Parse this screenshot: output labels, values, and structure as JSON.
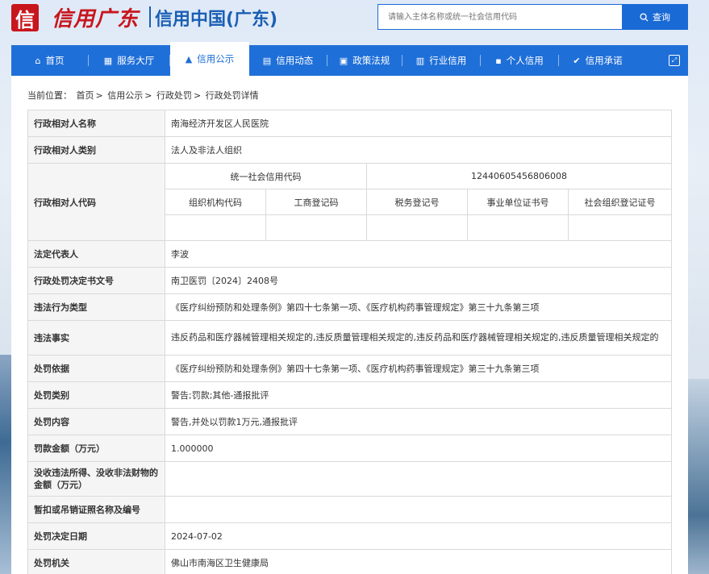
{
  "header": {
    "logo_char": "信",
    "logo_script": "信用广东",
    "site_title": "信用中国(广东)",
    "search_placeholder": "请输入主体名称或统一社会信用代码",
    "search_button": "查询"
  },
  "nav": [
    {
      "label": "首页",
      "icon": "home-icon",
      "glyph": "⌂"
    },
    {
      "label": "服务大厅",
      "icon": "grid-icon",
      "glyph": "▦"
    },
    {
      "label": "信用公示",
      "icon": "announce-icon",
      "glyph": "▲"
    },
    {
      "label": "信用动态",
      "icon": "document-icon",
      "glyph": "▤"
    },
    {
      "label": "政策法规",
      "icon": "book-icon",
      "glyph": "▣"
    },
    {
      "label": "行业信用",
      "icon": "building-icon",
      "glyph": "▥"
    },
    {
      "label": "个人信用",
      "icon": "id-card-icon",
      "glyph": "▪"
    },
    {
      "label": "信用承诺",
      "icon": "shield-check-icon",
      "glyph": "✔"
    }
  ],
  "breadcrumb": {
    "prefix": "当前位置：",
    "items": [
      "首页",
      "信用公示",
      "行政处罚",
      "行政处罚详情"
    ]
  },
  "table": {
    "name_label": "行政相对人名称",
    "name_value": "南海经济开发区人民医院",
    "category_label": "行政相对人类别",
    "category_value": "法人及非法人组织",
    "code_label": "行政相对人代码",
    "uscc_label": "统一社会信用代码",
    "uscc_value": "12440605456806008",
    "sub_headers": [
      "组织机构代码",
      "工商登记码",
      "税务登记号",
      "事业单位证书号",
      "社会组织登记证号"
    ],
    "rows": [
      {
        "label": "法定代表人",
        "value": "李波"
      },
      {
        "label": "行政处罚决定书文号",
        "value": "南卫医罚〔2024〕2408号"
      },
      {
        "label": "违法行为类型",
        "value": "《医疗纠纷预防和处理条例》第四十七条第一项、《医疗机构药事管理规定》第三十九条第三项"
      },
      {
        "label": "违法事实",
        "value": "违反药品和医疗器械管理相关规定的,违反质量管理相关规定的,违反药品和医疗器械管理相关规定的,违反质量管理相关规定的"
      },
      {
        "label": "处罚依据",
        "value": "《医疗纠纷预防和处理条例》第四十七条第一项、《医疗机构药事管理规定》第三十九条第三项"
      },
      {
        "label": "处罚类别",
        "value": "警告;罚款;其他-通报批评"
      },
      {
        "label": "处罚内容",
        "value": "警告,并处以罚款1万元,通报批评"
      },
      {
        "label": "罚款金额（万元）",
        "value": "1.000000"
      },
      {
        "label": "没收违法所得、没收非法财物的金额（万元）",
        "value": ""
      },
      {
        "label": "暂扣或吊销证照名称及编号",
        "value": ""
      },
      {
        "label": "处罚决定日期",
        "value": "2024-07-02"
      },
      {
        "label": "处罚机关",
        "value": "佛山市南海区卫生健康局"
      }
    ]
  }
}
